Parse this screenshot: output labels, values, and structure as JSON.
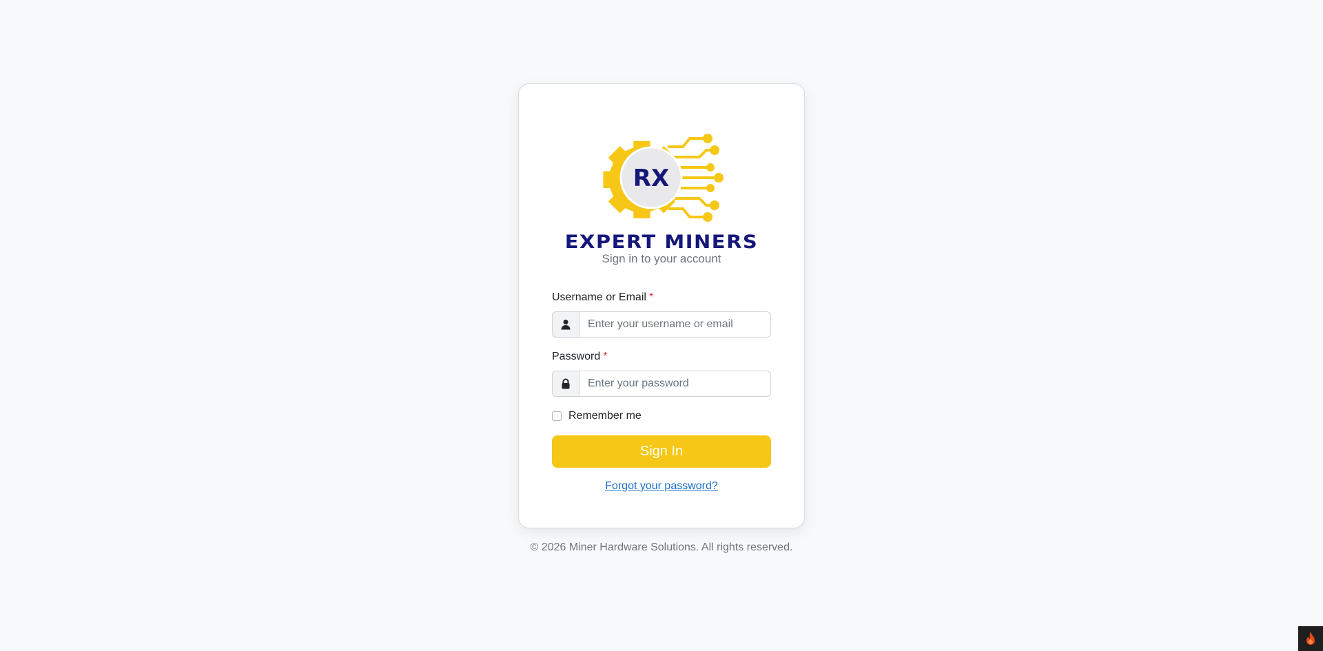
{
  "brand": {
    "logo_text": "RX",
    "name": "EXPERT MINERS",
    "subtitle": "Sign in to your account"
  },
  "form": {
    "username": {
      "label": "Username or Email",
      "required_mark": "*",
      "placeholder": "Enter your username or email",
      "icon": "user-icon"
    },
    "password": {
      "label": "Password",
      "required_mark": "*",
      "placeholder": "Enter your password",
      "icon": "lock-icon"
    },
    "remember_label": "Remember me",
    "submit_label": "Sign In",
    "forgot_link": "Forgot your password?"
  },
  "footer": {
    "copyright": "© 2026 Miner Hardware Solutions. All rights reserved."
  },
  "colors": {
    "accent": "#f6c716",
    "brand_navy": "#15177a",
    "link": "#1a6fc9",
    "required": "#dc3545"
  },
  "corner_widget": {
    "icon": "flame-icon"
  }
}
